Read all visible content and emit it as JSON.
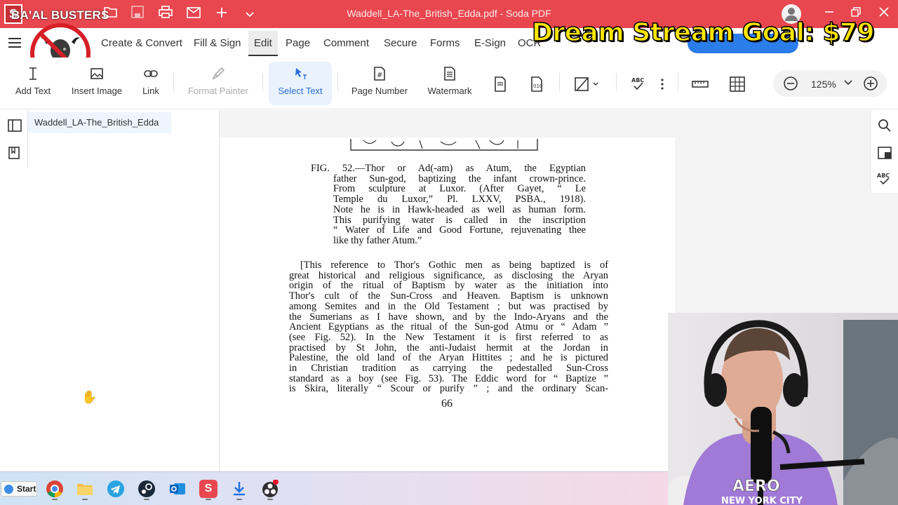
{
  "title_bar": {
    "overlay_title": "BA'AL BUSTERS",
    "app_logo": "S",
    "doc_title": "Waddell_LA-The_British_Edda.pdf  -  Soda PDF"
  },
  "menu": {
    "items": [
      "Create & Convert",
      "Fill & Sign",
      "Edit",
      "Page",
      "Comment",
      "Secure",
      "Forms",
      "E-Sign",
      "OCR"
    ],
    "active": "Edit"
  },
  "stream_goal": "Dream Stream Goal: $79",
  "toolbar": {
    "add_text": "Add Text",
    "insert_image": "Insert Image",
    "link": "Link",
    "format_painter": "Format Painter",
    "select_text": "Select Text",
    "page_number": "Page Number",
    "watermark": "Watermark",
    "spell_label": "ABC",
    "zoom": "125%"
  },
  "document": {
    "tab_name": "Waddell_LA-The_British_Edda",
    "caption_lines": [
      "FIG. 52.—Thor or Ad(-am) as Atum, the Egyptian",
      "father Sun-god, baptizing the infant crown-prince.",
      "From sculpture at Luxor. (After Gayet, “ Le",
      "Temple du Luxor,” Pl. LXXV, PSBA., 1918).",
      "Note he is in Hawk-headed as well as human form.",
      "This purifying water is called in the inscription",
      "“ Water of Life and Good Fortune, rejuvenating thee",
      "like thy father Atum.”"
    ],
    "body_lines": [
      "[This reference to Thor's Gothic men as being baptized is of",
      "great historical and religious significance, as disclosing the Aryan",
      "origin of the ritual of Baptism by water as the initiation into",
      "Thor's cult of the Sun-Cross and Heaven. Baptism is unknown",
      "among Semites and in the Old Testament ; but was practised by",
      "the Sumerians as I have shown, and by the Indo-Aryans and the",
      "Ancient Egyptians as the ritual of the Sun-god Atmu or “ Adam ”",
      "(see Fig. 52). In the New Testament it is first referred to as",
      "practised by St John, the anti-Judaist hermit at the Jordan in",
      "Palestine, the old land of the Aryan Hittites ; and he is pictured",
      "in Christian tradition as carrying the pedestalled Sun-Cross",
      "standard as a boy (see Fig. 53). The Eddic word for “ Baptize ”",
      "is Skira, literally “ Scour or purify ” ; and the ordinary Scan-"
    ],
    "page_number": "66"
  },
  "taskbar": {
    "start_label": "Start",
    "apps": [
      "chrome-icon",
      "file-explorer-icon",
      "telegram-icon",
      "steam-icon",
      "outlook-icon",
      "soda-pdf-icon",
      "download-icon",
      "obs-icon"
    ]
  },
  "webcam": {
    "shirt_text_top": "AERO",
    "shirt_text_bottom": "NEW YORK CITY"
  },
  "colors": {
    "title_bar": "#e8474f",
    "accent_blue": "#2b7de9",
    "goal_text": "#ffe600"
  }
}
